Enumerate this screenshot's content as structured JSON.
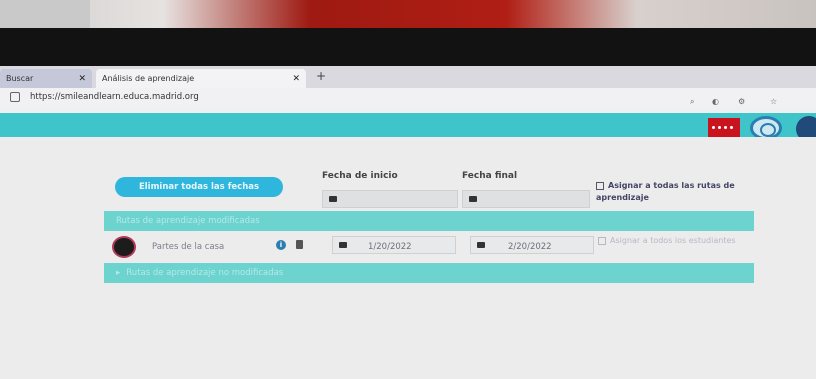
{
  "browser": {
    "tabs": [
      {
        "label": "Buscar"
      },
      {
        "label": "Análisis de aprendizaje"
      }
    ],
    "new_tab": "+",
    "url": "https://smileandlearn.educa.madrid.org"
  },
  "page": {
    "remove_dates_button": "Eliminar todas las fechas",
    "start_date_header": "Fecha de inicio",
    "end_date_header": "Fecha final",
    "assign_all_routes": "Asignar a todas las rutas de aprendizaje",
    "modified_section": "Rutas de aprendizaje modificadas",
    "unmodified_section": "Rutas de aprendizaje no modificadas",
    "unmodified_toggle": "▸",
    "route": {
      "name": "Partes de la casa",
      "start_date": "1/20/2022",
      "end_date": "2/20/2022",
      "assign_students": "Asignar a todos los estudiantes"
    }
  },
  "colors": {
    "appbar": "#3fc5c9",
    "button": "#2fb6dc",
    "section": "#6dd3cf"
  }
}
